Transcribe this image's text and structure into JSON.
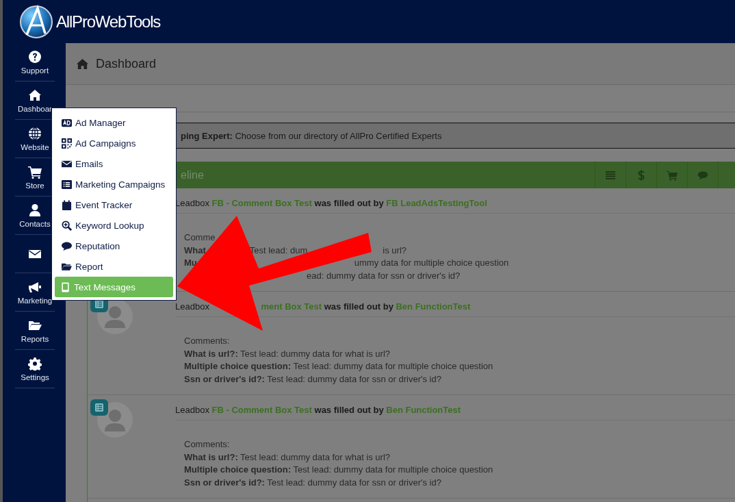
{
  "brand": {
    "name": "AllProWebTools"
  },
  "sidebar": {
    "items": [
      {
        "kind": "labeled",
        "label": "Support"
      },
      {
        "kind": "labeled",
        "label": "Dashboar"
      },
      {
        "kind": "labeled",
        "label": "Website"
      },
      {
        "kind": "labeled",
        "label": "Store"
      },
      {
        "kind": "labeled",
        "label": "Contacts"
      },
      {
        "kind": "icon"
      },
      {
        "kind": "labeled",
        "label": "Marketing"
      },
      {
        "kind": "labeled",
        "label": "Reports"
      },
      {
        "kind": "labeled",
        "label": "Settings"
      }
    ]
  },
  "page_title": "Dashboard",
  "banner": "**ping Expert:** Choose from our directory of AllPro Certified Experts",
  "timeline": {
    "title": "eline",
    "entries": [
      {
        "prefix": "Leadbox",
        "form": "FB - Comment Box Test",
        "middle": "was filled out by",
        "by": "FB LeadAdsTestingTool",
        "comments_label": "Comme",
        "fields": [
          [
            "**What**",
            "Test lead: dum",
            "is url?"
          ],
          [
            "**Mu**",
            "ummy data for multiple choice question"
          ],
          [
            "ead: dummy data for ssn or driver's id?"
          ]
        ]
      },
      {
        "avatar": true,
        "prefix": "Leadbox",
        "form": "ment Box Test",
        "middle": "was filled out by",
        "by": "Ben FunctionTest",
        "comments_label": "Comments:",
        "fields": [
          "**What is url?:** Test lead: dummy data for what is url?",
          "**Multiple choice question:** Test lead: dummy data for multiple choice question",
          "**Ssn or driver's id?:** Test lead: dummy data for ssn or driver's id?"
        ]
      },
      {
        "avatar": true,
        "prefix": "Leadbox",
        "form": "FB - Comment Box Test",
        "middle": "was filled out by",
        "by": "Ben FunctionTest",
        "comments_label": "Comments:",
        "fields": [
          "**What is url?:** Test lead: dummy data for what is url?",
          "**Multiple choice question:** Test lead: dummy data for multiple choice question",
          "**Ssn or driver's id?:** Test lead: dummy data for ssn or driver's id?"
        ]
      }
    ]
  },
  "marketing_menu": {
    "items": [
      {
        "label": "Ad Manager",
        "selected": false
      },
      {
        "label": "Ad Campaigns",
        "selected": false
      },
      {
        "label": "Emails",
        "selected": false
      },
      {
        "label": "Marketing Campaigns",
        "selected": false
      },
      {
        "label": "Event Tracker",
        "selected": false
      },
      {
        "label": "Keyword Lookup",
        "selected": false
      },
      {
        "label": "Reputation",
        "selected": false
      },
      {
        "label": "Report",
        "selected": false
      },
      {
        "label": "Text Messages",
        "selected": true
      }
    ]
  }
}
